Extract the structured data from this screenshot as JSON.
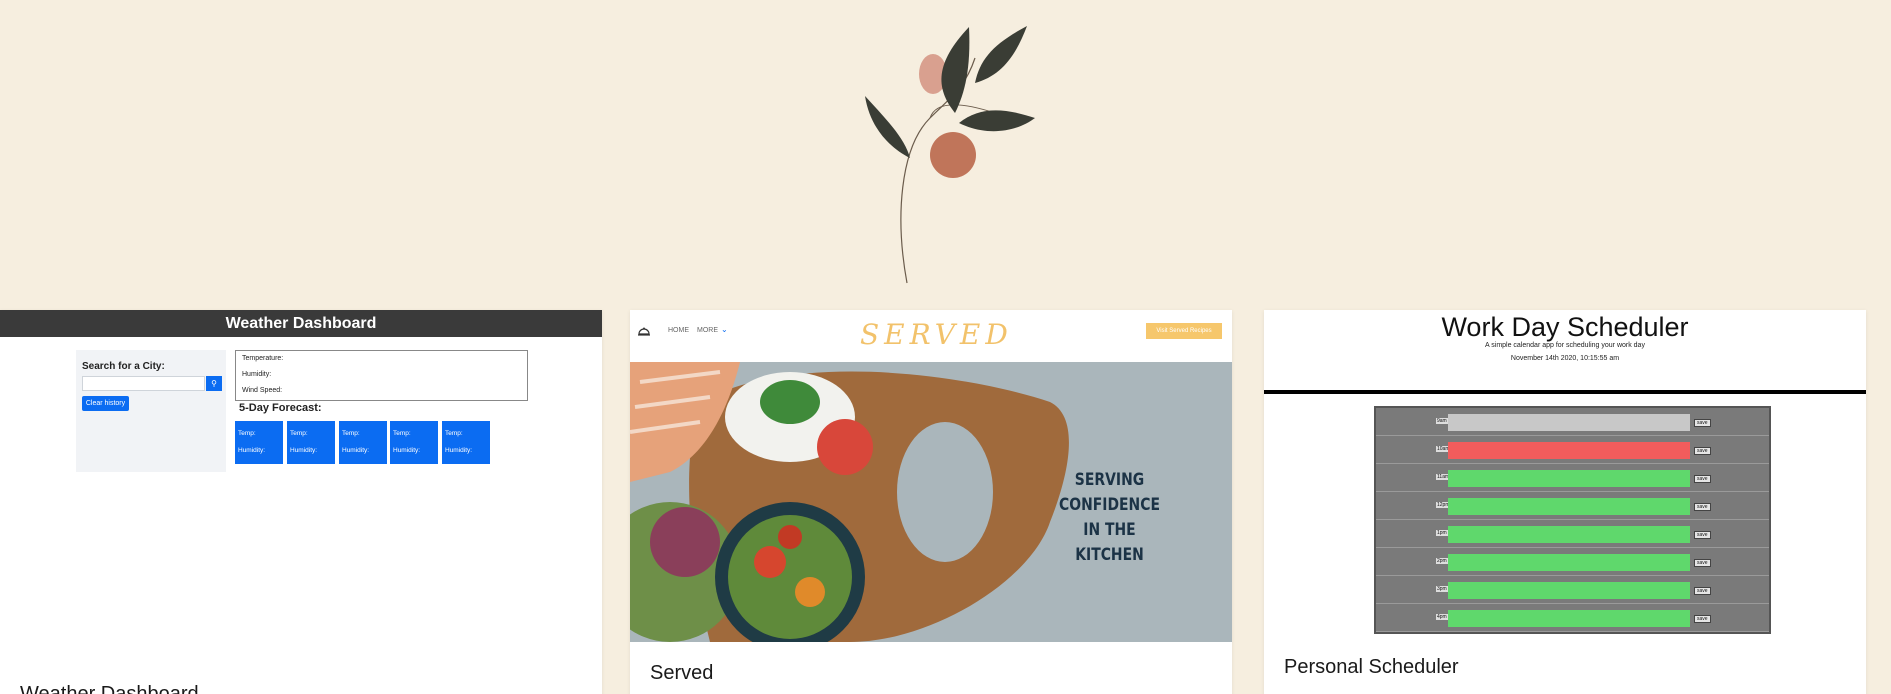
{
  "colors": {
    "page_bg": "#f6eedf",
    "leaf_dark": "#3a3d35",
    "berry": "#c0755a",
    "berry_light": "#d9a08f",
    "weather_header": "#3a3a3a",
    "primary_blue": "#0b6cf2",
    "served_gold": "#f2c26b",
    "slot_past": "#c8c8c8",
    "slot_present": "#f25c5c",
    "slot_future": "#5fd86c"
  },
  "decoration": {
    "icon": "plant-sprig-icon"
  },
  "projects": [
    {
      "title": "Weather Dashboard",
      "screenshot": {
        "header": "Weather Dashboard",
        "search_label": "Search for a City:",
        "search_icon": "magnifier-icon",
        "clear_button": "Clear history",
        "current": {
          "temperature": "Temperature:",
          "humidity": "Humidity:",
          "wind": "Wind Speed:"
        },
        "forecast_title": "5-Day Forecast:",
        "forecast_cards": [
          {
            "temp": "Temp:",
            "humidity": "Humidity:"
          },
          {
            "temp": "Temp:",
            "humidity": "Humidity:"
          },
          {
            "temp": "Temp:",
            "humidity": "Humidity:"
          },
          {
            "temp": "Temp:",
            "humidity": "Humidity:"
          },
          {
            "temp": "Temp:",
            "humidity": "Humidity:"
          }
        ]
      }
    },
    {
      "title": "Served",
      "screenshot": {
        "logo_icon": "cloche-icon",
        "nav": {
          "home": "HOME",
          "more": "MORE"
        },
        "brand": "SERVED",
        "cta": "Visit Served Recipes",
        "hero_lines": [
          "SERVING CONFIDENCE",
          "IN THE",
          "KITCHEN"
        ]
      }
    },
    {
      "title": "Personal Scheduler",
      "screenshot": {
        "title": "Work Day Scheduler",
        "subtitle": "A simple calendar app for scheduling your work day",
        "date": "November 14th 2020, 10:15:55 am",
        "rows": [
          {
            "hour": "9am",
            "state": "past",
            "save": "save"
          },
          {
            "hour": "10am",
            "state": "present",
            "save": "save"
          },
          {
            "hour": "11am",
            "state": "future",
            "save": "save"
          },
          {
            "hour": "12pm",
            "state": "future",
            "save": "save"
          },
          {
            "hour": "1pm",
            "state": "future",
            "save": "save"
          },
          {
            "hour": "2pm",
            "state": "future",
            "save": "save"
          },
          {
            "hour": "3pm",
            "state": "future",
            "save": "save"
          },
          {
            "hour": "4pm",
            "state": "future",
            "save": "save"
          }
        ]
      }
    }
  ]
}
